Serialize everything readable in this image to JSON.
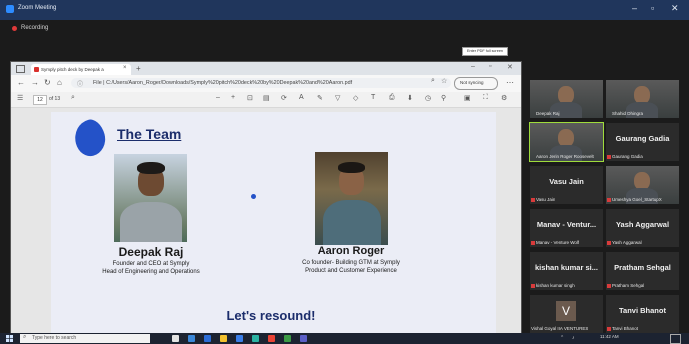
{
  "zoom": {
    "title": "Zoom Meeting",
    "recording": "Recording"
  },
  "browser": {
    "tab_title": "Symply pitch deck by Deepak a",
    "url": "File  |  C:/Users/Aaron_Roger/Downloads/Symply%20pitch%20deck%20by%20Deepak%20and%20Aaron.pdf",
    "not_syncing": "Not syncing",
    "page_current": "12",
    "page_total": "of 13",
    "tooltip": "Enter PDF full screen"
  },
  "slide": {
    "title": "The Team",
    "person1": {
      "name": "Deepak Raj",
      "role_line1": "Founder and CEO at Symply",
      "role_line2": "Head of Engineering and Operations"
    },
    "person2": {
      "name": "Aaron Roger",
      "role_line1": "Co founder- Building GTM at Symply",
      "role_line2": "Product and Customer Experience"
    },
    "footer": "Let's resound!"
  },
  "participants": [
    {
      "label": "Deepak Raj",
      "type": "video"
    },
    {
      "label": "Shahid Dhingra",
      "type": "video"
    },
    {
      "label": "Aaron Jerin Roger Roosevelt",
      "type": "video",
      "active": true
    },
    {
      "name": "Gaurang Gadia",
      "label": "Gaurang Gadia",
      "type": "name"
    },
    {
      "name": "Vasu Jain",
      "label": "Vasu Jain",
      "type": "name"
    },
    {
      "label": "Umeshya Goel_StartupX",
      "type": "video"
    },
    {
      "name": "Manav - Ventur...",
      "label": "Manav - Venture Wolf",
      "type": "name"
    },
    {
      "name": "Yash Aggarwal",
      "label": "Yash Aggarwal",
      "type": "name"
    },
    {
      "name": "kishan kumar si...",
      "label": "kishan kumar singh",
      "type": "name"
    },
    {
      "name": "Pratham Sehgal",
      "label": "Pratham Sehgal",
      "type": "name"
    },
    {
      "name": "V",
      "label": "Vishal Goyal IIA VENTURES",
      "type": "avatar"
    },
    {
      "name": "Tanvi Bhanot",
      "label": "Tanvi Bhanot",
      "type": "name"
    }
  ],
  "taskbar": {
    "search_placeholder": "Type here to search",
    "time": "11:42 AM"
  },
  "colors": {
    "zoom_bar": "#20365c",
    "accent": "#2452c8",
    "active_speaker": "#9fdc3b"
  }
}
